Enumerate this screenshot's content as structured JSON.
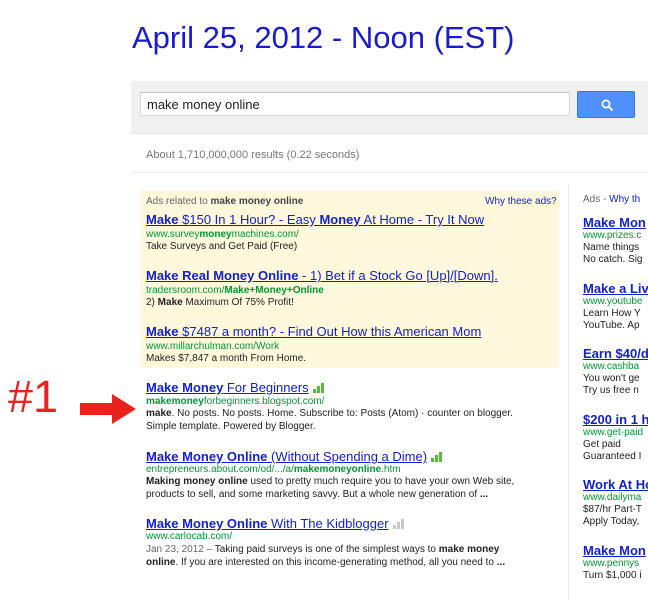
{
  "caption": "April 25, 2012 - Noon (EST)",
  "annotation": {
    "label": "#1"
  },
  "search": {
    "query": "make money online"
  },
  "stats": "About 1,710,000,000 results (0.22 seconds)",
  "ads_top": {
    "header_prefix": "Ads related to ",
    "header_query": "make money online",
    "why": "Why these ads?",
    "items": [
      {
        "title": [
          "Make",
          " $150 In 1 Hour? - Easy ",
          "Money",
          " At Home - Try It Now"
        ],
        "url": [
          "www.survey",
          "money",
          "machines.com/"
        ],
        "desc": "Take Surveys and Get Paid (Free)"
      },
      {
        "title": [
          "Make Real Money Online",
          " - 1) Bet if a Stock Go [Up]/[Down]."
        ],
        "url": [
          "tradersroom.com/",
          "Make+Money+Online"
        ],
        "desc": [
          "2) ",
          "Make",
          " Maximum Of 75% Profit!"
        ]
      },
      {
        "title": [
          "Make",
          " $7487 a month? - Find Out How this American Mom"
        ],
        "url": "www.millarchulman.com/Work",
        "desc": "Makes $7,847 a month From Home."
      }
    ]
  },
  "results": [
    {
      "title": [
        "Make Money",
        " For Beginners"
      ],
      "url": [
        "makemoney",
        "forbeginners.blogspot.com/"
      ],
      "desc1": [
        "make",
        ". No posts. No posts. Home. Subscribe to: Posts (Atom) · counter on blogger."
      ],
      "desc2": "Simple template. Powered by Blogger."
    },
    {
      "title": [
        "Make Money Online",
        " (Without Spending a Dime)"
      ],
      "url": [
        "entrepreneurs.about.com/od/.../a/",
        "makemoneyonline",
        ".htm"
      ],
      "desc1": [
        "Making money online",
        " used to pretty much require you to have your own Web site,"
      ],
      "desc2": [
        "products to sell, and some marketing savvy. But a whole new generation of ",
        "..."
      ]
    },
    {
      "title": [
        "Make Money Online",
        " With The Kidblogger"
      ],
      "url": "www.carlocab.com/",
      "desc1": [
        "Jan 23, 2012 – ",
        "Taking paid surveys is one of the simplest ways to ",
        "make money"
      ],
      "desc2": [
        "online",
        ". If you are interested on this income-generating method, all you need to ",
        "..."
      ]
    }
  ],
  "ads_right": {
    "header_prefix": "Ads - ",
    "header_link": "Why th",
    "items": [
      {
        "title": "Make Mon",
        "url": "www.prizes.c",
        "desc": [
          "Name things",
          "No catch. Sig"
        ]
      },
      {
        "title": "Make a Liv",
        "url": "www.youtube",
        "desc": [
          "Learn How Y",
          "YouTube. Ap"
        ]
      },
      {
        "title": "Earn $40/d",
        "url": "www.cashba",
        "desc": [
          "You won't ge",
          "Try us free n"
        ]
      },
      {
        "title": "$200 in 1 h",
        "url": "www.get-paid",
        "desc": [
          "Get paid",
          "Guaranteed I"
        ]
      },
      {
        "title": "Work At Ho",
        "url": "www.dailyma",
        "desc": [
          "$87/hr Part-T",
          "Apply Today,"
        ]
      },
      {
        "title": "Make Mon",
        "url": "www.pennys",
        "desc": [
          "Turn $1,000 i"
        ]
      }
    ]
  },
  "colors": {
    "link": "#1122cc",
    "url": "#009933",
    "ad_bg": "#fff8dd",
    "caption": "#1a1acf",
    "annotation": "#e8231e"
  }
}
